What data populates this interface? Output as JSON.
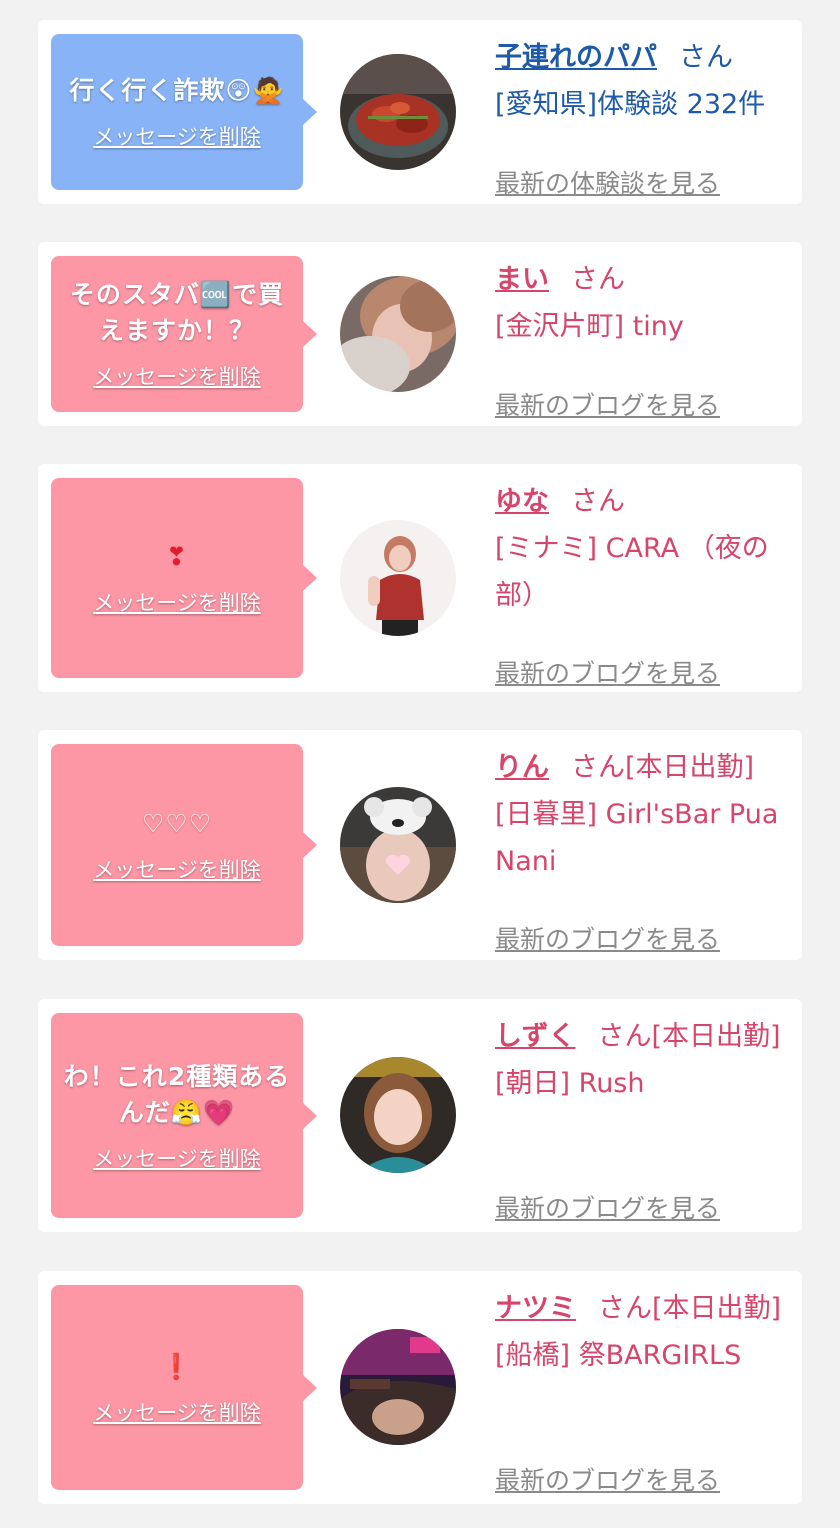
{
  "rows": [
    {
      "message": "行く行く詐欺",
      "message_emoji": "😲🙅",
      "delete_label": "メッセージを削除",
      "name": "子連れのパパ",
      "honorific": "さん",
      "detail": "[愛知県]体験談 232件",
      "link_label": "最新の体験談を見る",
      "accent": "#1e5aa8",
      "bubble_color": "#88b4f7",
      "avatar_subject": "food-photo"
    },
    {
      "message": "そのスタバ🆒で買えますか！？",
      "delete_label": "メッセージを削除",
      "name": "まい",
      "honorific": "さん",
      "detail": "[金沢片町] tiny",
      "link_label": "最新のブログを見る",
      "accent": "#d6456b",
      "bubble_color": "#fd96a5",
      "avatar_subject": "person-photo"
    },
    {
      "message": "❣",
      "delete_label": "メッセージを削除",
      "name": "ゆな",
      "honorific": "さん",
      "detail": "[ミナミ] CARA （夜の部）",
      "link_label": "最新のブログを見る",
      "accent": "#d6456b",
      "bubble_color": "#fd96a5",
      "avatar_subject": "person-photo"
    },
    {
      "message": "♡♡♡",
      "delete_label": "メッセージを削除",
      "name": "りん",
      "honorific": "さん[本日出勤]",
      "detail": "[日暮里] Girl'sBar Pua Nani",
      "link_label": "最新のブログを見る",
      "accent": "#d6456b",
      "bubble_color": "#fd96a5",
      "avatar_subject": "person-photo"
    },
    {
      "message": "わ！これ2種類あるんだ",
      "message_emoji": "😤💗",
      "delete_label": "メッセージを削除",
      "name": "しずく",
      "honorific": "さん[本日出勤]",
      "detail": "[朝日] Rush",
      "link_label": "最新のブログを見る",
      "accent": "#d6456b",
      "bubble_color": "#fd96a5",
      "avatar_subject": "person-photo"
    },
    {
      "message": "❗",
      "delete_label": "メッセージを削除",
      "name": "ナツミ",
      "honorific": "さん[本日出勤]",
      "detail": "[船橋] 祭BARGIRLS",
      "link_label": "最新のブログを見る",
      "accent": "#d6456b",
      "bubble_color": "#fd96a5",
      "avatar_subject": "person-photo"
    }
  ]
}
